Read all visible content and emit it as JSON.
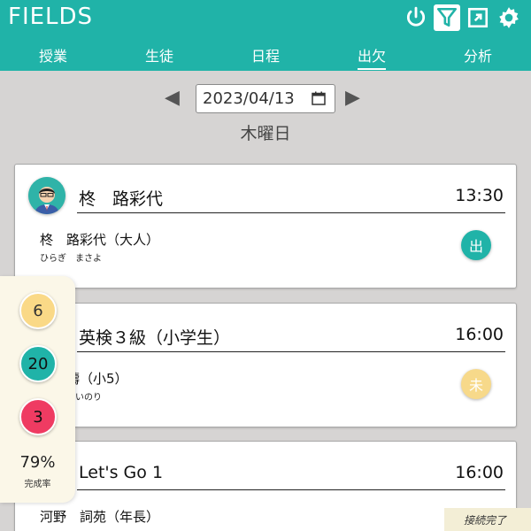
{
  "app": {
    "title": "FIELDS"
  },
  "header_icons": [
    "power-icon",
    "filter-icon",
    "expand-icon",
    "gear-icon"
  ],
  "nav": {
    "tabs": [
      {
        "label": "授業"
      },
      {
        "label": "生徒"
      },
      {
        "label": "日程"
      },
      {
        "label": "出欠",
        "active": true
      },
      {
        "label": "分析"
      }
    ]
  },
  "date": {
    "value": "2023/04/13",
    "weekday": "木曜日"
  },
  "cards": [
    {
      "title": "柊　路彩代",
      "time": "13:30",
      "student": "柊　路彩代（大人）",
      "kana": "ひらぎ　まさよ",
      "status": "出"
    },
    {
      "title": "英検３級（小学生）",
      "time": "16:00",
      "student": "東　禱（小5）",
      "kana": "ひがし　いのり",
      "status": "未"
    },
    {
      "title": "Let's Go 1",
      "time": "16:00",
      "student": "河野　詞苑（年長）"
    }
  ],
  "stats": {
    "pending": "6",
    "present": "20",
    "absent": "3",
    "rate": "79%",
    "rate_label": "完成率"
  },
  "connection": {
    "status": "接続完了"
  },
  "colors": {
    "accent": "#20b3a8",
    "absent": "#ef3b62",
    "pending": "#fad987",
    "background": "#d6d4d3"
  }
}
